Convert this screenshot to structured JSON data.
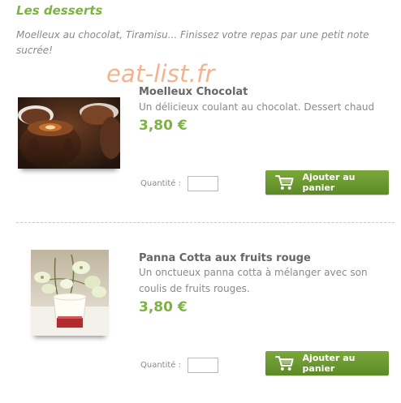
{
  "section": {
    "title": "Les desserts",
    "intro": "Moelleux au chocolat, Tiramisu... Finissez votre repas par une petit note sucrée!"
  },
  "watermark": "eat-list.fr",
  "products": [
    {
      "name": "Moelleux Chocolat",
      "description": "Un délicieux coulant au chocolat. Dessert chaud",
      "price": "3,80 €",
      "quantity_label": "Quantité :",
      "quantity_value": "",
      "button_label": "Ajouter au panier",
      "image_icon": "chocolate-lava-cake-photo"
    },
    {
      "name": "Panna Cotta aux fruits rouge",
      "description": "Un onctueux panna cotta à mélanger avec son coulis de fruits rouges.",
      "price": "3,80 €",
      "quantity_label": "Quantité :",
      "quantity_value": "",
      "button_label": "Ajouter au panier",
      "image_icon": "panna-cotta-photo"
    }
  ],
  "colors": {
    "accent_green": "#7cb342",
    "button_green": "#6a9a2e",
    "watermark": "#f2b38e"
  }
}
